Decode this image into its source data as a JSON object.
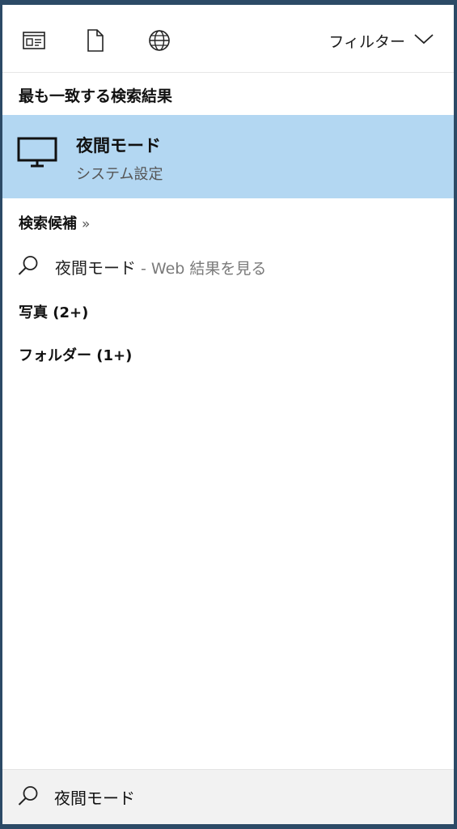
{
  "toolbar": {
    "icons": [
      "apps-icon",
      "document-icon",
      "web-globe-icon"
    ],
    "filter_label": "フィルター"
  },
  "best_match": {
    "heading": "最も一致する検索結果",
    "title": "夜間モード",
    "subtitle": "システム設定"
  },
  "suggestions": {
    "heading": "検索候補",
    "chevron": "»",
    "web_query": "夜間モード",
    "web_suffix": " - Web 結果を見る"
  },
  "categories": {
    "photos": "写真 (2+)",
    "folders": "フォルダー (1+)"
  },
  "search": {
    "value": "夜間モード"
  },
  "colors": {
    "highlight": "#b3d7f2",
    "search_bar_bg": "#f2f2f2"
  }
}
